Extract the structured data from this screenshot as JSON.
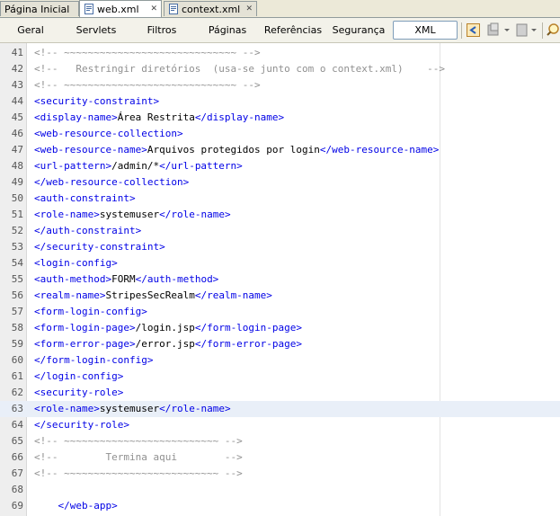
{
  "tabs": [
    {
      "label": "Página Inicial",
      "active": false
    },
    {
      "label": "web.xml",
      "active": true
    },
    {
      "label": "context.xml",
      "active": false
    }
  ],
  "views": [
    "Geral",
    "Servlets",
    "Filtros",
    "Páginas",
    "Referências",
    "Segurança",
    "XML"
  ],
  "active_view": "XML",
  "toolbar_icons": [
    "back-to-source-icon",
    "history-icon",
    "dropdown-arrow-icon",
    "document-icon",
    "dropdown-arrow-icon",
    "search-icon"
  ],
  "colors": {
    "tag": "#0000e6",
    "comment": "#909090",
    "highlight": "#e9eff8"
  },
  "lines": [
    {
      "n": "41",
      "parts": [
        {
          "c": "cm",
          "t": "<!-- ~~~~~~~~~~~~~~~~~~~~~~~~~~~~~ -->"
        }
      ]
    },
    {
      "n": "42",
      "parts": [
        {
          "c": "cm",
          "t": "<!--   Restringir diretórios  (usa-se junto com o context.xml)    -->"
        }
      ]
    },
    {
      "n": "43",
      "parts": [
        {
          "c": "cm",
          "t": "<!-- ~~~~~~~~~~~~~~~~~~~~~~~~~~~~~ -->"
        }
      ]
    },
    {
      "n": "44",
      "parts": [
        {
          "c": "tag",
          "t": "<security-constraint>"
        }
      ]
    },
    {
      "n": "45",
      "parts": [
        {
          "c": "tag",
          "t": "<display-name>"
        },
        {
          "c": "tx",
          "t": "Área Restrita"
        },
        {
          "c": "tag",
          "t": "</display-name>"
        }
      ]
    },
    {
      "n": "46",
      "parts": [
        {
          "c": "tag",
          "t": "<web-resource-collection>"
        }
      ]
    },
    {
      "n": "47",
      "parts": [
        {
          "c": "tag",
          "t": "<web-resource-name>"
        },
        {
          "c": "tx",
          "t": "Arquivos protegidos por login"
        },
        {
          "c": "tag",
          "t": "</web-resource-name>"
        }
      ]
    },
    {
      "n": "48",
      "parts": [
        {
          "c": "tag",
          "t": "<url-pattern>"
        },
        {
          "c": "tx",
          "t": "/admin/*"
        },
        {
          "c": "tag",
          "t": "</url-pattern>"
        }
      ]
    },
    {
      "n": "49",
      "parts": [
        {
          "c": "tag",
          "t": "</web-resource-collection>"
        }
      ]
    },
    {
      "n": "50",
      "parts": [
        {
          "c": "tag",
          "t": "<auth-constraint>"
        }
      ]
    },
    {
      "n": "51",
      "parts": [
        {
          "c": "tag",
          "t": "<role-name>"
        },
        {
          "c": "tx",
          "t": "systemuser"
        },
        {
          "c": "tag",
          "t": "</role-name>"
        }
      ]
    },
    {
      "n": "52",
      "parts": [
        {
          "c": "tag",
          "t": "</auth-constraint>"
        }
      ]
    },
    {
      "n": "53",
      "parts": [
        {
          "c": "tag",
          "t": "</security-constraint>"
        }
      ]
    },
    {
      "n": "54",
      "parts": [
        {
          "c": "tag",
          "t": "<login-config>"
        }
      ]
    },
    {
      "n": "55",
      "parts": [
        {
          "c": "tag",
          "t": "<auth-method>"
        },
        {
          "c": "tx",
          "t": "FORM"
        },
        {
          "c": "tag",
          "t": "</auth-method>"
        }
      ]
    },
    {
      "n": "56",
      "parts": [
        {
          "c": "tag",
          "t": "<realm-name>"
        },
        {
          "c": "tx",
          "t": "StripesSecRealm"
        },
        {
          "c": "tag",
          "t": "</realm-name>"
        }
      ]
    },
    {
      "n": "57",
      "parts": [
        {
          "c": "tag",
          "t": "<form-login-config>"
        }
      ]
    },
    {
      "n": "58",
      "parts": [
        {
          "c": "tag",
          "t": "<form-login-page>"
        },
        {
          "c": "tx",
          "t": "/login.jsp"
        },
        {
          "c": "tag",
          "t": "</form-login-page>"
        }
      ]
    },
    {
      "n": "59",
      "parts": [
        {
          "c": "tag",
          "t": "<form-error-page>"
        },
        {
          "c": "tx",
          "t": "/error.jsp"
        },
        {
          "c": "tag",
          "t": "</form-error-page>"
        }
      ]
    },
    {
      "n": "60",
      "parts": [
        {
          "c": "tag",
          "t": "</form-login-config>"
        }
      ]
    },
    {
      "n": "61",
      "parts": [
        {
          "c": "tag",
          "t": "</login-config>"
        }
      ]
    },
    {
      "n": "62",
      "parts": [
        {
          "c": "tag",
          "t": "<security-role>"
        }
      ]
    },
    {
      "n": "63",
      "parts": [
        {
          "c": "tag",
          "t": "<role-name>"
        },
        {
          "c": "tx",
          "t": "systemuser"
        },
        {
          "c": "tag",
          "t": "</role-name>"
        }
      ],
      "highlight": true
    },
    {
      "n": "64",
      "parts": [
        {
          "c": "tag",
          "t": "</security-role>"
        }
      ]
    },
    {
      "n": "65",
      "parts": [
        {
          "c": "cm",
          "t": "<!-- ~~~~~~~~~~~~~~~~~~~~~~~~~~ -->"
        }
      ]
    },
    {
      "n": "66",
      "parts": [
        {
          "c": "cm",
          "t": "<!--        Termina aqui        -->"
        }
      ]
    },
    {
      "n": "67",
      "parts": [
        {
          "c": "cm",
          "t": "<!-- ~~~~~~~~~~~~~~~~~~~~~~~~~~ -->"
        }
      ]
    },
    {
      "n": "68",
      "parts": []
    },
    {
      "n": "69",
      "parts": [
        {
          "c": "tx",
          "t": "    "
        },
        {
          "c": "tag",
          "t": "</web-app>"
        }
      ]
    }
  ]
}
